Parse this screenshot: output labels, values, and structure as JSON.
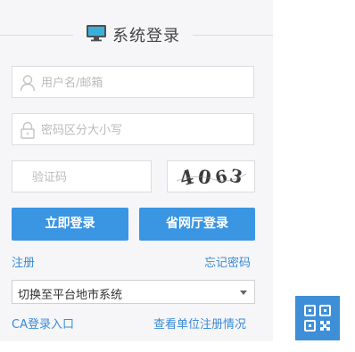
{
  "header": {
    "title": "系统登录",
    "icon": "monitor-icon"
  },
  "username": {
    "placeholder": "用户名/邮箱",
    "value": "",
    "icon": "user-icon"
  },
  "password": {
    "placeholder": "密码区分大小写",
    "value": "",
    "icon": "lock-icon"
  },
  "captcha": {
    "placeholder": "验证码",
    "value": "",
    "image_text": "4063"
  },
  "buttons": {
    "login": "立即登录",
    "provincial_login": "省网厅登录"
  },
  "links": {
    "register": "注册",
    "forgot_password": "忘记密码",
    "ca_login": "CA登录入口",
    "view_registration": "查看单位注册情况"
  },
  "platform_select": {
    "selected": "切换至平台地市系统"
  },
  "qr_button": {
    "icon": "qr-code-icon"
  },
  "colors": {
    "accent": "#3a95e3",
    "link": "#3a8ad9",
    "qr_bg": "#3f8fd8",
    "panel_bg": "#f6f6f8"
  }
}
